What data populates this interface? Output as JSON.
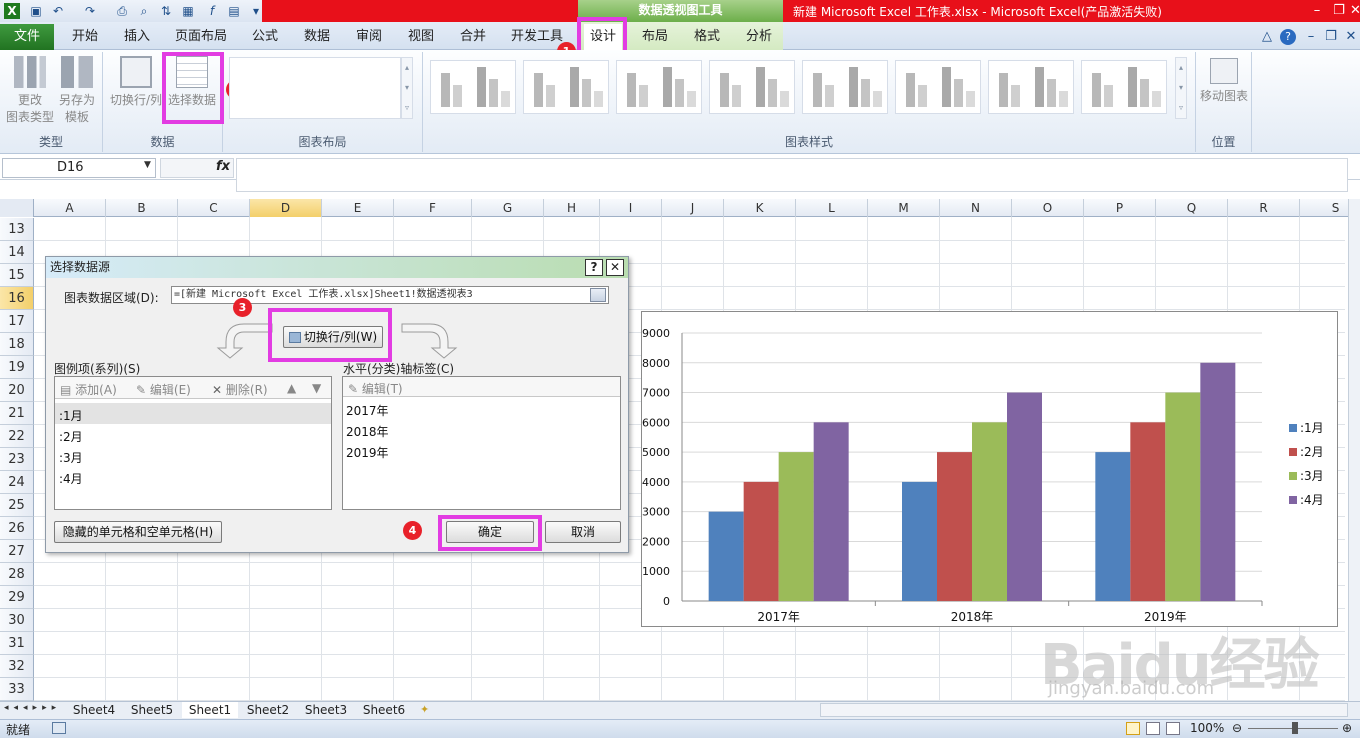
{
  "window": {
    "title": "新建 Microsoft Excel 工作表.xlsx - Microsoft Excel(产品激活失败)",
    "context_tool": "数据透视图工具"
  },
  "tabs": [
    "文件",
    "开始",
    "插入",
    "页面布局",
    "公式",
    "数据",
    "审阅",
    "视图",
    "合并",
    "开发工具",
    "设计",
    "布局",
    "格式",
    "分析"
  ],
  "ribbon": {
    "type_group": {
      "label": "类型",
      "change_btn": "更改\n图表类型",
      "saveas_btn": "另存为\n模板"
    },
    "data_group": {
      "label": "数据",
      "switch_btn": "切换行/列",
      "select_btn": "选择数据"
    },
    "layout_group": {
      "label": "图表布局"
    },
    "styles_group": {
      "label": "图表样式"
    },
    "position_group": {
      "label": "位置",
      "move_btn": "移动图表"
    }
  },
  "formula_bar": {
    "name_box": "D16",
    "fx": "fx",
    "formula": ""
  },
  "columns": [
    "A",
    "B",
    "C",
    "D",
    "E",
    "F",
    "G",
    "H",
    "I",
    "J",
    "K",
    "L",
    "M",
    "N",
    "O",
    "P",
    "Q",
    "R",
    "S"
  ],
  "rows": [
    "13",
    "14",
    "15",
    "16",
    "17",
    "18",
    "19",
    "20",
    "21",
    "22",
    "23",
    "24",
    "25",
    "26",
    "27",
    "28",
    "29",
    "30",
    "31",
    "32",
    "33"
  ],
  "dialog": {
    "title": "选择数据源",
    "help": "?",
    "close": "✕",
    "range_label": "图表数据区域(D):",
    "range_value": "=[新建 Microsoft Excel 工作表.xlsx]Sheet1!数据透视表3",
    "switch_btn": "切换行/列(W)",
    "series_label": "图例项(系列)(S)",
    "series_add": "添加(A)",
    "series_edit": "编辑(E)",
    "series_delete": "删除(R)",
    "series_items": [
      ":1月",
      ":2月",
      ":3月",
      ":4月"
    ],
    "axis_label": "水平(分类)轴标签(C)",
    "axis_edit": "编辑(T)",
    "axis_items": [
      "2017年",
      "2018年",
      "2019年"
    ],
    "hidden_btn": "隐藏的单元格和空单元格(H)",
    "ok_btn": "确定",
    "cancel_btn": "取消"
  },
  "badges": [
    "1",
    "2",
    "3",
    "4"
  ],
  "chart_data": {
    "type": "bar",
    "categories": [
      "2017年",
      "2018年",
      "2019年"
    ],
    "series": [
      {
        "name": ":1月",
        "values": [
          3000,
          4000,
          5000
        ],
        "color": "#4f81bd"
      },
      {
        "name": ":2月",
        "values": [
          4000,
          5000,
          6000
        ],
        "color": "#c0504d"
      },
      {
        "name": ":3月",
        "values": [
          5000,
          6000,
          7000
        ],
        "color": "#9bbb59"
      },
      {
        "name": ":4月",
        "values": [
          6000,
          7000,
          8000
        ],
        "color": "#8064a2"
      }
    ],
    "ylim": [
      0,
      9000
    ],
    "yticks": [
      "0",
      "1000",
      "2000",
      "3000",
      "4000",
      "5000",
      "6000",
      "7000",
      "8000",
      "9000"
    ],
    "legend": "right",
    "grid": true
  },
  "sheets": [
    "Sheet4",
    "Sheet5",
    "Sheet1",
    "Sheet2",
    "Sheet3",
    "Sheet6"
  ],
  "status": {
    "ready": "就绪",
    "zoom": "100%"
  },
  "watermark": {
    "main": "Baidu经验",
    "sub": "jingyan.baidu.com"
  }
}
